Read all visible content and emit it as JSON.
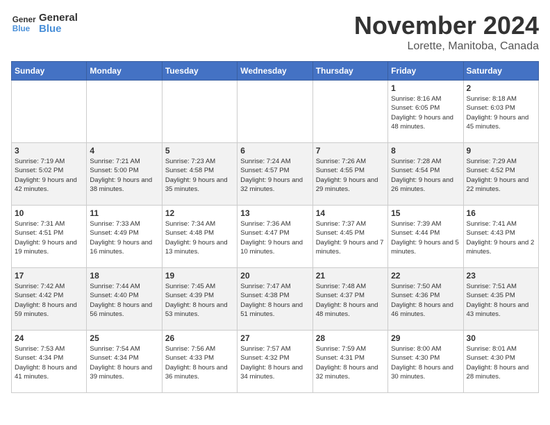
{
  "logo": {
    "line1": "General",
    "line2": "Blue"
  },
  "title": "November 2024",
  "location": "Lorette, Manitoba, Canada",
  "days_of_week": [
    "Sunday",
    "Monday",
    "Tuesday",
    "Wednesday",
    "Thursday",
    "Friday",
    "Saturday"
  ],
  "weeks": [
    [
      {
        "day": "",
        "info": ""
      },
      {
        "day": "",
        "info": ""
      },
      {
        "day": "",
        "info": ""
      },
      {
        "day": "",
        "info": ""
      },
      {
        "day": "",
        "info": ""
      },
      {
        "day": "1",
        "info": "Sunrise: 8:16 AM\nSunset: 6:05 PM\nDaylight: 9 hours and 48 minutes."
      },
      {
        "day": "2",
        "info": "Sunrise: 8:18 AM\nSunset: 6:03 PM\nDaylight: 9 hours and 45 minutes."
      }
    ],
    [
      {
        "day": "3",
        "info": "Sunrise: 7:19 AM\nSunset: 5:02 PM\nDaylight: 9 hours and 42 minutes."
      },
      {
        "day": "4",
        "info": "Sunrise: 7:21 AM\nSunset: 5:00 PM\nDaylight: 9 hours and 38 minutes."
      },
      {
        "day": "5",
        "info": "Sunrise: 7:23 AM\nSunset: 4:58 PM\nDaylight: 9 hours and 35 minutes."
      },
      {
        "day": "6",
        "info": "Sunrise: 7:24 AM\nSunset: 4:57 PM\nDaylight: 9 hours and 32 minutes."
      },
      {
        "day": "7",
        "info": "Sunrise: 7:26 AM\nSunset: 4:55 PM\nDaylight: 9 hours and 29 minutes."
      },
      {
        "day": "8",
        "info": "Sunrise: 7:28 AM\nSunset: 4:54 PM\nDaylight: 9 hours and 26 minutes."
      },
      {
        "day": "9",
        "info": "Sunrise: 7:29 AM\nSunset: 4:52 PM\nDaylight: 9 hours and 22 minutes."
      }
    ],
    [
      {
        "day": "10",
        "info": "Sunrise: 7:31 AM\nSunset: 4:51 PM\nDaylight: 9 hours and 19 minutes."
      },
      {
        "day": "11",
        "info": "Sunrise: 7:33 AM\nSunset: 4:49 PM\nDaylight: 9 hours and 16 minutes."
      },
      {
        "day": "12",
        "info": "Sunrise: 7:34 AM\nSunset: 4:48 PM\nDaylight: 9 hours and 13 minutes."
      },
      {
        "day": "13",
        "info": "Sunrise: 7:36 AM\nSunset: 4:47 PM\nDaylight: 9 hours and 10 minutes."
      },
      {
        "day": "14",
        "info": "Sunrise: 7:37 AM\nSunset: 4:45 PM\nDaylight: 9 hours and 7 minutes."
      },
      {
        "day": "15",
        "info": "Sunrise: 7:39 AM\nSunset: 4:44 PM\nDaylight: 9 hours and 5 minutes."
      },
      {
        "day": "16",
        "info": "Sunrise: 7:41 AM\nSunset: 4:43 PM\nDaylight: 9 hours and 2 minutes."
      }
    ],
    [
      {
        "day": "17",
        "info": "Sunrise: 7:42 AM\nSunset: 4:42 PM\nDaylight: 8 hours and 59 minutes."
      },
      {
        "day": "18",
        "info": "Sunrise: 7:44 AM\nSunset: 4:40 PM\nDaylight: 8 hours and 56 minutes."
      },
      {
        "day": "19",
        "info": "Sunrise: 7:45 AM\nSunset: 4:39 PM\nDaylight: 8 hours and 53 minutes."
      },
      {
        "day": "20",
        "info": "Sunrise: 7:47 AM\nSunset: 4:38 PM\nDaylight: 8 hours and 51 minutes."
      },
      {
        "day": "21",
        "info": "Sunrise: 7:48 AM\nSunset: 4:37 PM\nDaylight: 8 hours and 48 minutes."
      },
      {
        "day": "22",
        "info": "Sunrise: 7:50 AM\nSunset: 4:36 PM\nDaylight: 8 hours and 46 minutes."
      },
      {
        "day": "23",
        "info": "Sunrise: 7:51 AM\nSunset: 4:35 PM\nDaylight: 8 hours and 43 minutes."
      }
    ],
    [
      {
        "day": "24",
        "info": "Sunrise: 7:53 AM\nSunset: 4:34 PM\nDaylight: 8 hours and 41 minutes."
      },
      {
        "day": "25",
        "info": "Sunrise: 7:54 AM\nSunset: 4:34 PM\nDaylight: 8 hours and 39 minutes."
      },
      {
        "day": "26",
        "info": "Sunrise: 7:56 AM\nSunset: 4:33 PM\nDaylight: 8 hours and 36 minutes."
      },
      {
        "day": "27",
        "info": "Sunrise: 7:57 AM\nSunset: 4:32 PM\nDaylight: 8 hours and 34 minutes."
      },
      {
        "day": "28",
        "info": "Sunrise: 7:59 AM\nSunset: 4:31 PM\nDaylight: 8 hours and 32 minutes."
      },
      {
        "day": "29",
        "info": "Sunrise: 8:00 AM\nSunset: 4:30 PM\nDaylight: 8 hours and 30 minutes."
      },
      {
        "day": "30",
        "info": "Sunrise: 8:01 AM\nSunset: 4:30 PM\nDaylight: 8 hours and 28 minutes."
      }
    ]
  ]
}
